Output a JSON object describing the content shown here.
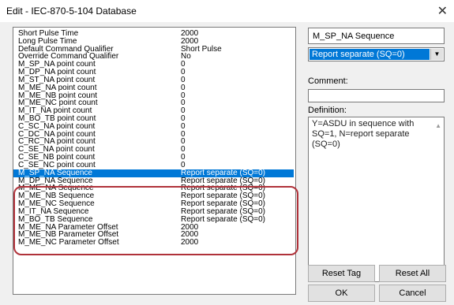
{
  "window": {
    "title": "Edit - IEC-870-5-104 Database",
    "close_glyph": "✕"
  },
  "list": {
    "rows": [
      {
        "name": "Short Pulse Time",
        "value": "2000"
      },
      {
        "name": "Long Pulse Time",
        "value": "2000"
      },
      {
        "name": "Default Command Qualifier",
        "value": "Short Pulse"
      },
      {
        "name": "Override Command Qualifier",
        "value": "No"
      },
      {
        "name": "M_SP_NA point count",
        "value": "0"
      },
      {
        "name": "M_DP_NA point count",
        "value": "0"
      },
      {
        "name": "M_ST_NA point count",
        "value": "0"
      },
      {
        "name": "M_ME_NA point count",
        "value": "0"
      },
      {
        "name": "M_ME_NB point count",
        "value": "0"
      },
      {
        "name": "M_ME_NC point count",
        "value": "0"
      },
      {
        "name": "M_IT_NA point count",
        "value": "0"
      },
      {
        "name": "M_BO_TB point count",
        "value": "0"
      },
      {
        "name": "C_SC_NA point count",
        "value": "0"
      },
      {
        "name": "C_DC_NA point count",
        "value": "0"
      },
      {
        "name": "C_RC_NA point count",
        "value": "0"
      },
      {
        "name": "C_SE_NA point count",
        "value": "0"
      },
      {
        "name": "C_SE_NB point count",
        "value": "0"
      },
      {
        "name": "C_SE_NC point count",
        "value": "0"
      },
      {
        "name": "M_SP_NA Sequence",
        "value": "Report separate (SQ=0)"
      },
      {
        "name": "M_DP_NA Sequence",
        "value": "Report separate (SQ=0)"
      },
      {
        "name": "M_ME_NA Sequence",
        "value": "Report separate (SQ=0)"
      },
      {
        "name": "M_ME_NB Sequence",
        "value": "Report separate (SQ=0)"
      },
      {
        "name": "M_ME_NC Sequence",
        "value": "Report separate (SQ=0)"
      },
      {
        "name": "M_IT_NA Sequence",
        "value": "Report separate (SQ=0)"
      },
      {
        "name": "M_BO_TB Sequence",
        "value": "Report separate (SQ=0)"
      },
      {
        "name": "M_ME_NA Parameter Offset",
        "value": "2000"
      },
      {
        "name": "M_ME_NB Parameter Offset",
        "value": "2000"
      },
      {
        "name": "M_ME_NC Parameter Offset",
        "value": "2000"
      }
    ],
    "selected_row": "M_SP_NA Sequence"
  },
  "panel": {
    "parameter_name": "M_SP_NA Sequence",
    "selected_value": "Report separate (SQ=0)",
    "comment_label": "Comment:",
    "comment_value": "",
    "definition_label": "Definition:",
    "definition_text": "Y=ASDU in sequence with SQ=1, N=report separate (SQ=0)"
  },
  "buttons": {
    "reset_tag": "Reset Tag",
    "reset_all": "Reset All",
    "ok": "OK",
    "cancel": "Cancel"
  },
  "colors": {
    "selection": "#0078d7",
    "highlight_border": "#b0323a"
  }
}
